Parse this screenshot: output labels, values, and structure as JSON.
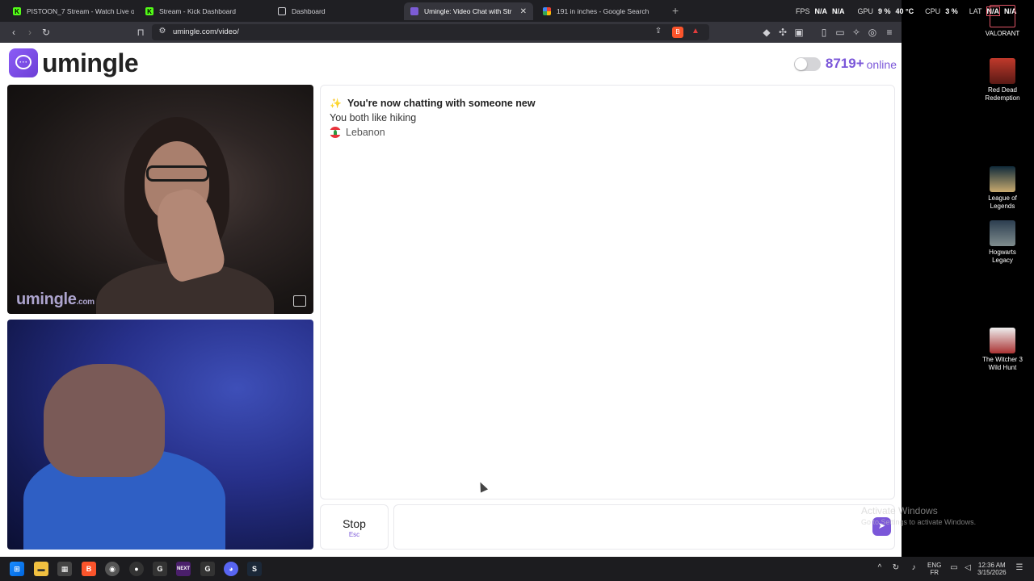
{
  "browser": {
    "tabs": [
      {
        "label": "PISTOON_7 Stream - Watch Live on K",
        "icon": "kick-icon"
      },
      {
        "label": "Stream - Kick Dashboard",
        "icon": "kick-icon"
      },
      {
        "label": "Dashboard",
        "icon": "globe-icon"
      },
      {
        "label": "Umingle: Video Chat with Str",
        "icon": "umingle-icon"
      },
      {
        "label": "191 in inches - Google Search",
        "icon": "google-icon"
      }
    ],
    "url": "umingle.com/video/",
    "hud": {
      "fps_label": "FPS",
      "fps_a": "N/A",
      "fps_b": "N/A",
      "gpu_label": "GPU",
      "gpu_pct": "9 %",
      "gpu_temp": "40 °C",
      "cpu_label": "CPU",
      "cpu_pct": "3 %",
      "lat_label": "LAT",
      "lat_a": "N/A",
      "lat_b": "N/A"
    }
  },
  "page": {
    "logo_text": "umingle",
    "online_count": "8719+",
    "online_label": "online",
    "watermark_main": "umingle",
    "watermark_suffix": ".com",
    "chat": {
      "line1": "You're now chatting with someone new",
      "line2": "You both like hiking",
      "country": "Lebanon"
    },
    "stop_label": "Stop",
    "stop_key": "Esc",
    "colors": {
      "accent": "#7b57d9"
    }
  },
  "desktop": {
    "icons": [
      {
        "label": "VALORANT"
      },
      {
        "label": "Red Dead Redemption"
      },
      {
        "label": "League of Legends"
      },
      {
        "label": "Hogwarts Legacy"
      },
      {
        "label": "The Witcher 3 Wild Hunt"
      }
    ],
    "activate_title": "Activate Windows",
    "activate_sub": "Go to Settings to activate Windows."
  },
  "taskbar": {
    "lang_1": "ENG",
    "lang_2": "FR",
    "time": "12:36 AM",
    "date": "3/15/2026"
  }
}
